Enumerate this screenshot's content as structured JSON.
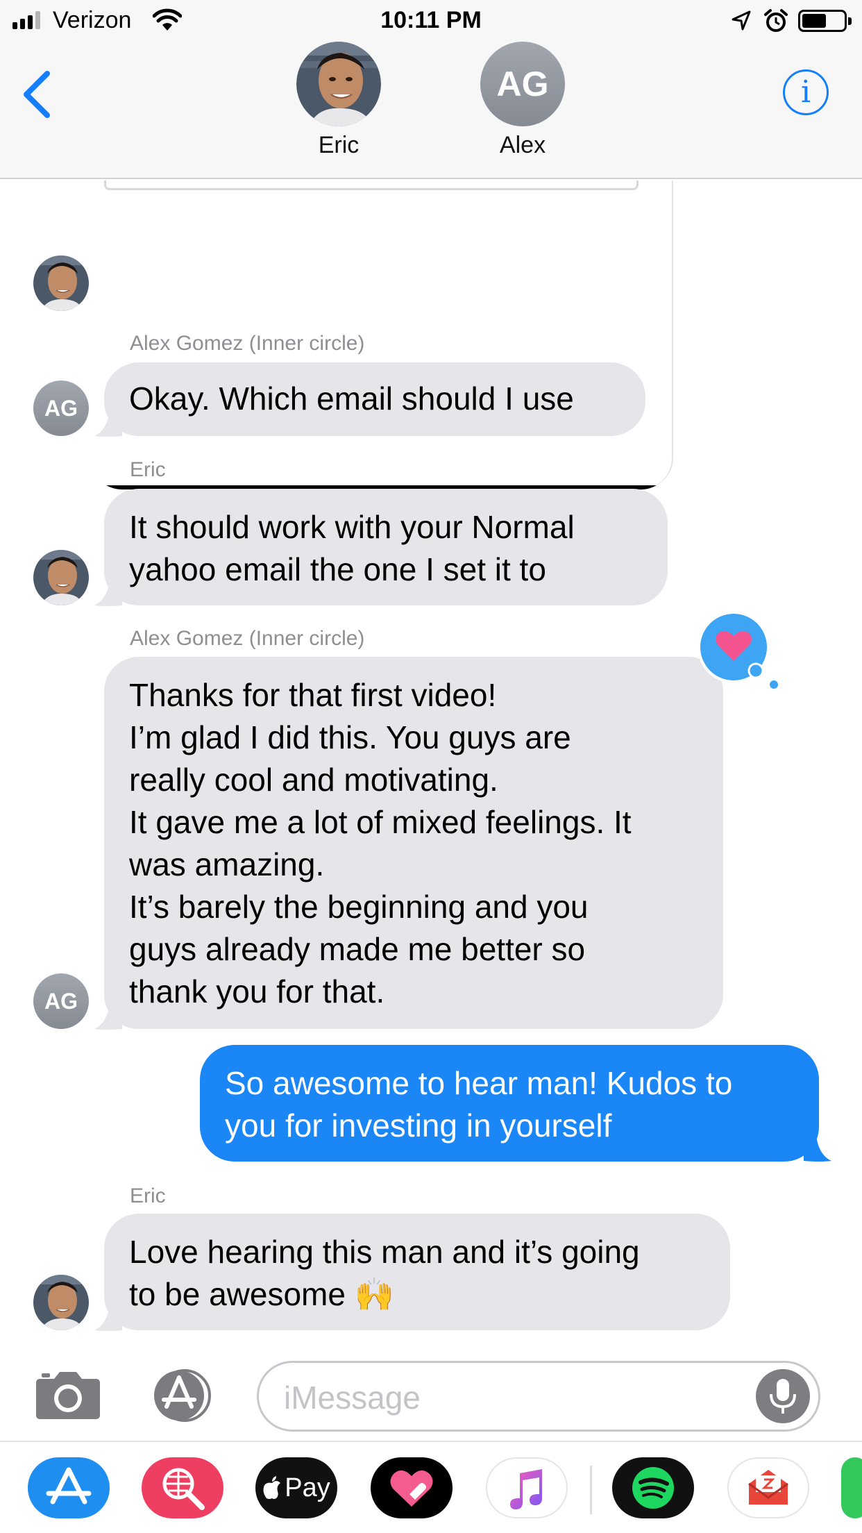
{
  "status_bar": {
    "carrier": "Verizon",
    "time": "10:11 PM",
    "signal_bars_active": 3,
    "signal_bars_total": 4,
    "battery_level": 0.55
  },
  "header": {
    "participants": [
      {
        "name": "Eric",
        "avatar": "photo"
      },
      {
        "name": "Alex",
        "initials": "AG"
      }
    ],
    "back_icon": "chevron-left-icon",
    "info_icon": "info-icon",
    "info_glyph": "i"
  },
  "messages": [
    {
      "sender_label": "Alex Gomez (Inner circle)",
      "lines": [
        "Okay. Which email should I use"
      ],
      "avatar_initials": "AG"
    },
    {
      "sender_label": "Eric",
      "lines": [
        "It should work with your Normal",
        "yahoo email the one I set it to"
      ],
      "avatar": "photo"
    },
    {
      "sender_label": "Alex Gomez (Inner circle)",
      "lines": [
        "Thanks for that first video!",
        "I’m glad I did this. You guys are",
        "really cool and motivating.",
        "It gave me a lot of mixed feelings. It",
        "was amazing.",
        "It’s barely the beginning and you",
        "guys already made me better so",
        "thank you for that."
      ],
      "avatar_initials": "AG",
      "tapback": "heart-icon"
    },
    {
      "outgoing": true,
      "lines": [
        "So awesome to hear man! Kudos to",
        "you for investing in yourself"
      ]
    },
    {
      "sender_label": "Eric",
      "lines": [
        "Love hearing this man and it’s going",
        "to be awesome 🙌"
      ],
      "avatar": "photo"
    }
  ],
  "input_bar": {
    "placeholder": "iMessage",
    "camera_icon": "camera-icon",
    "apps_icon": "app-store-icon",
    "mic_icon": "microphone-icon"
  },
  "app_drawer": {
    "apple_pay_label": "Pay",
    "apps": [
      "app-store-icon",
      "web-images-icon",
      "apple-pay-icon",
      "digital-touch-icon",
      "music-icon",
      "spotify-icon",
      "mail-icon"
    ]
  },
  "colors": {
    "accent_blue": "#147efb",
    "outgoing_bubble": "#1b87f7",
    "incoming_bubble": "#e5e5ea",
    "sender_label": "#8e8e93",
    "tapback_blue": "#3da5f4",
    "heart_pink": "#f3538e"
  }
}
